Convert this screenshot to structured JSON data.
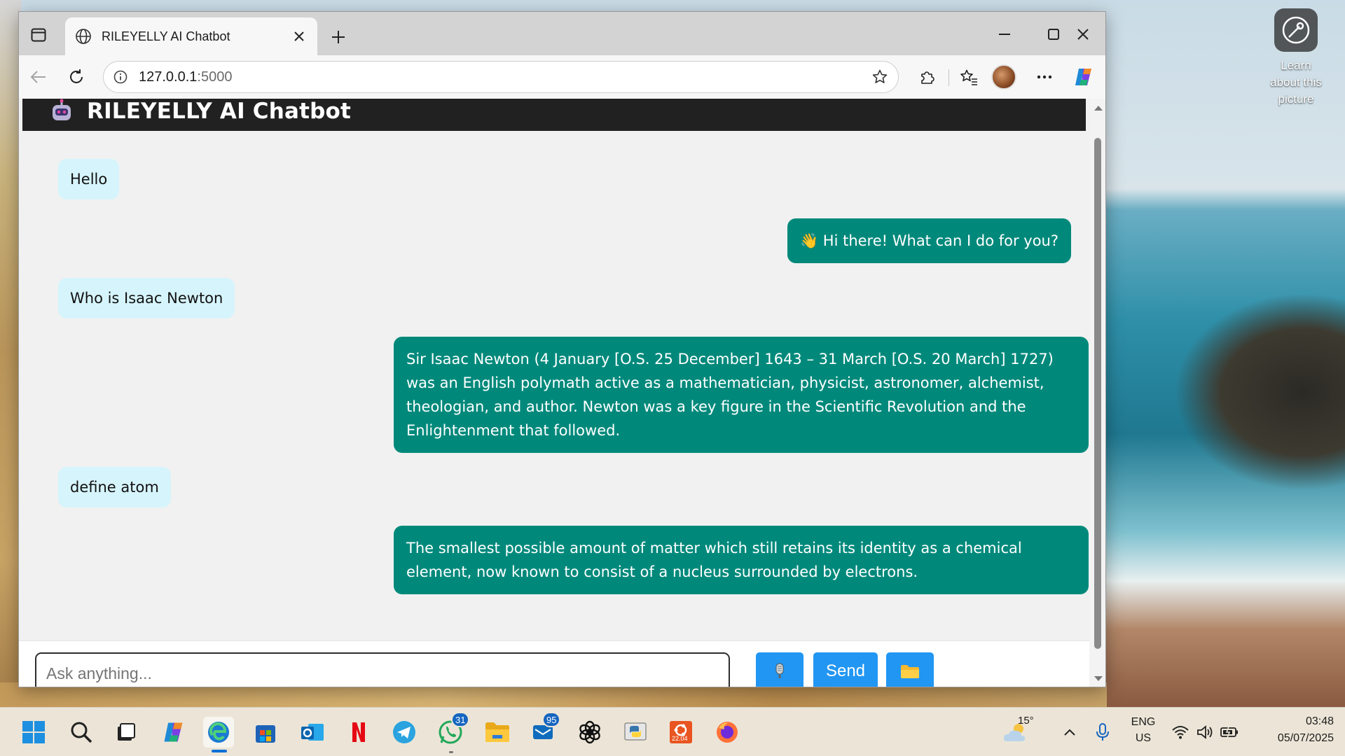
{
  "desktop": {
    "learn_widget": "Learn about this picture"
  },
  "browser": {
    "tab_title": "RILEYELLY AI Chatbot",
    "url_host": "127.0.0.1",
    "url_port": ":5000"
  },
  "app": {
    "title": "RILEYELLY AI Chatbot",
    "messages": [
      {
        "role": "user",
        "text": "Hello"
      },
      {
        "role": "bot",
        "text": "👋 Hi there! What can I do for you?"
      },
      {
        "role": "user",
        "text": "Who is Isaac Newton"
      },
      {
        "role": "bot",
        "text": "Sir Isaac Newton (4 January [O.S. 25 December] 1643 – 31 March [O.S. 20 March] 1727) was an English polymath active as a mathematician, physicist, astronomer, alchemist, theologian, and author. Newton was a key figure in the Scientific Revolution and the Enlightenment that followed."
      },
      {
        "role": "user",
        "text": "define atom"
      },
      {
        "role": "bot",
        "text": "The smallest possible amount of matter which still retains its identity as a chemical element, now known to consist of a nucleus surrounded by electrons."
      }
    ],
    "input_placeholder": "Ask anything...",
    "send_label": "Send"
  },
  "taskbar": {
    "whatsapp_badge": "31",
    "outlook_badge": "95",
    "ubuntu_label": "22.04",
    "weather_temp": "15°",
    "lang_line1": "ENG",
    "lang_line2": "US",
    "time": "03:48",
    "date": "05/07/2025"
  },
  "colors": {
    "header_bg": "#212121",
    "user_bubble": "#d6f4fb",
    "bot_bubble": "#00897b",
    "button_blue": "#2196f3"
  }
}
